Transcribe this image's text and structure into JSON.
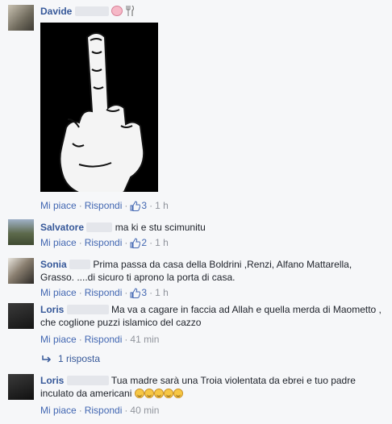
{
  "comments": [
    {
      "name": "Davide",
      "text": "",
      "actions": {
        "like": "Mi piace",
        "reply": "Rispondi",
        "likes": "3",
        "time": "1 h"
      }
    },
    {
      "name": "Salvatore",
      "text": "ma ki e stu scimunitu",
      "actions": {
        "like": "Mi piace",
        "reply": "Rispondi",
        "likes": "2",
        "time": "1 h"
      }
    },
    {
      "name": "Sonia",
      "text": "Prima passa da casa della Boldrini ,Renzi, Alfano Mattarella, Grasso. ....di sicuro ti aprono la porta di casa.",
      "actions": {
        "like": "Mi piace",
        "reply": "Rispondi",
        "likes": "3",
        "time": "1 h"
      }
    },
    {
      "name": "Loris",
      "text": "Ma va a cagare in faccia ad Allah e quella merda di Maometto , che coglione puzzi islamico del cazzo",
      "actions": {
        "like": "Mi piace",
        "reply": "Rispondi",
        "time": "41 min"
      },
      "replies_label": "1 risposta"
    },
    {
      "name": "Loris",
      "text": "Tua madre sarà una Troia violentata da ebrei e tuo padre inculato da americani",
      "actions": {
        "like": "Mi piace",
        "reply": "Rispondi",
        "time": "40 min"
      }
    }
  ],
  "colors": {
    "link": "#4267b2",
    "name": "#365899",
    "meta": "#90949c",
    "background": "#f6f7f9"
  }
}
